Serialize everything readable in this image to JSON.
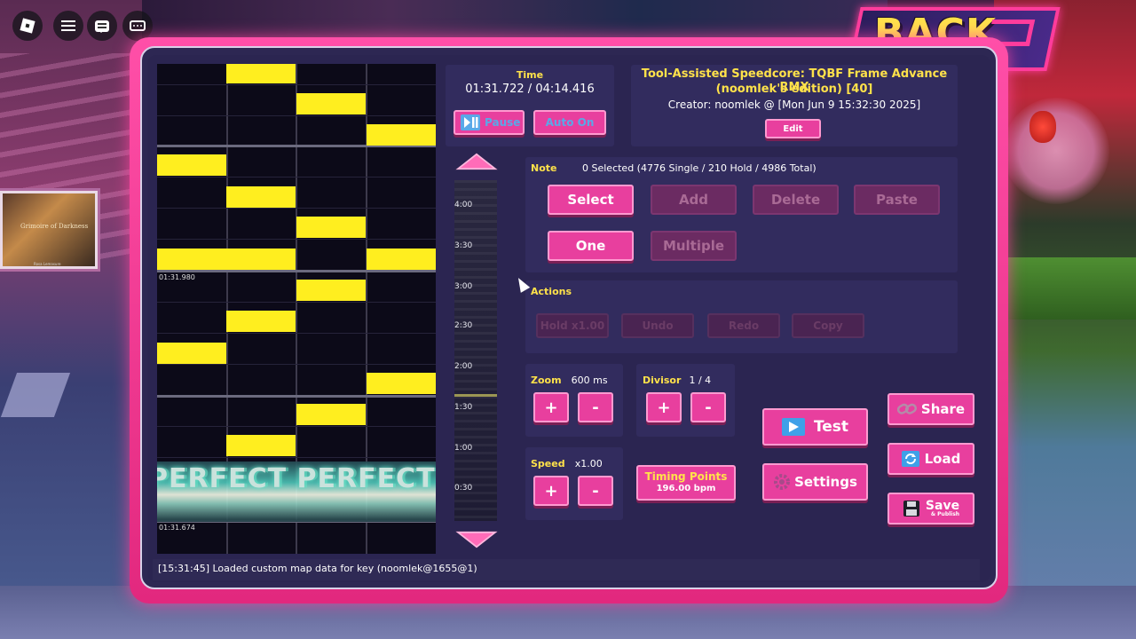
{
  "back_label": "BACK",
  "painting": {
    "title": "Grimoire of Darkness",
    "subtitle": "Rosa Lemasure"
  },
  "time": {
    "label": "Time",
    "value": "01:31.722 / 04:14.416",
    "pause_label": "Pause",
    "auto_label": "Auto On"
  },
  "song": {
    "title": "Tool-Assisted Speedcore: TQBF Frame Advance RMX",
    "subtitle": "(noomlek's edition) [40]",
    "creator": "Creator: noomlek @ [Mon Jun  9 15:32:30 2025]",
    "edit_label": "Edit"
  },
  "note_panel": {
    "label": "Note",
    "selection": "0 Selected (4776 Single / 210 Hold / 4986 Total)",
    "select": "Select",
    "add": "Add",
    "delete": "Delete",
    "paste": "Paste",
    "one": "One",
    "multiple": "Multiple"
  },
  "actions_panel": {
    "label": "Actions",
    "hold": "Hold x1.00",
    "undo": "Undo",
    "redo": "Redo",
    "copy": "Copy"
  },
  "zoom": {
    "label": "Zoom",
    "value": "600 ms",
    "plus": "+",
    "minus": "-"
  },
  "divisor": {
    "label": "Divisor",
    "value": "1 / 4",
    "plus": "+",
    "minus": "-"
  },
  "speed": {
    "label": "Speed",
    "value": "x1.00",
    "plus": "+",
    "minus": "-"
  },
  "timing": {
    "label": "Timing Points",
    "value": "196.00 bpm"
  },
  "buttons": {
    "test": "Test",
    "settings": "Settings",
    "share": "Share",
    "load": "Load",
    "save": "Save",
    "save_sub": "& Publish"
  },
  "timeline_labels": [
    "4:00",
    "3:30",
    "3:00",
    "2:30",
    "2:00",
    "1:30",
    "1:00",
    "0:30"
  ],
  "roll": {
    "time_top": "01:31.980",
    "time_bottom": "01:31.674",
    "judgement": "PERFECT PERFECT PERFECT PERFECT"
  },
  "status": "[15:31:45] Loaded custom map data for key (noomlek@1655@1)",
  "colors": {
    "accent": "#e83f9e",
    "note": "#ffee1f",
    "label": "#ffe24a",
    "panel": "#2d2753"
  }
}
